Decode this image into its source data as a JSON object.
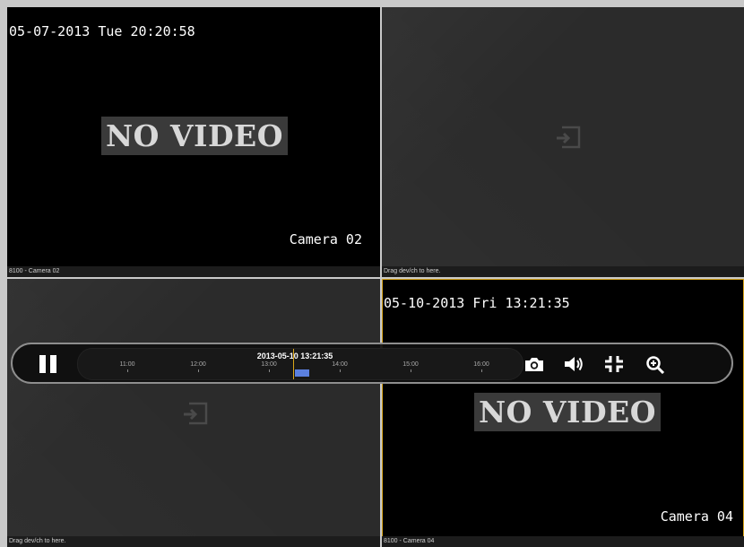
{
  "tiles": {
    "cam02": {
      "osd_time": "05-07-2013 Tue 20:20:58",
      "no_video": "NO VIDEO",
      "osd_camera": "Camera 02",
      "footer": "8100 - Camera 02"
    },
    "top_right": {
      "footer": "Drag dev/ch to here."
    },
    "bottom_left": {
      "footer": "Drag dev/ch to here."
    },
    "cam04": {
      "osd_time": "05-10-2013 Fri 13:21:35",
      "no_video": "NO VIDEO",
      "osd_camera": "Camera 04",
      "footer": "8100 - Camera 04"
    }
  },
  "playback": {
    "current_time": "2013-05-10 13:21:35",
    "ticks": [
      "11:00",
      "12:00",
      "13:00",
      "14:00",
      "15:00",
      "16:00"
    ],
    "controls": {
      "pause": "pause-icon",
      "snapshot": "camera-icon",
      "audio": "speaker-icon",
      "fullscreen": "exit-fullscreen-icon",
      "zoom": "zoom-in-icon"
    },
    "accent_color": "#d9a51a",
    "record_color": "#5b80e0"
  }
}
